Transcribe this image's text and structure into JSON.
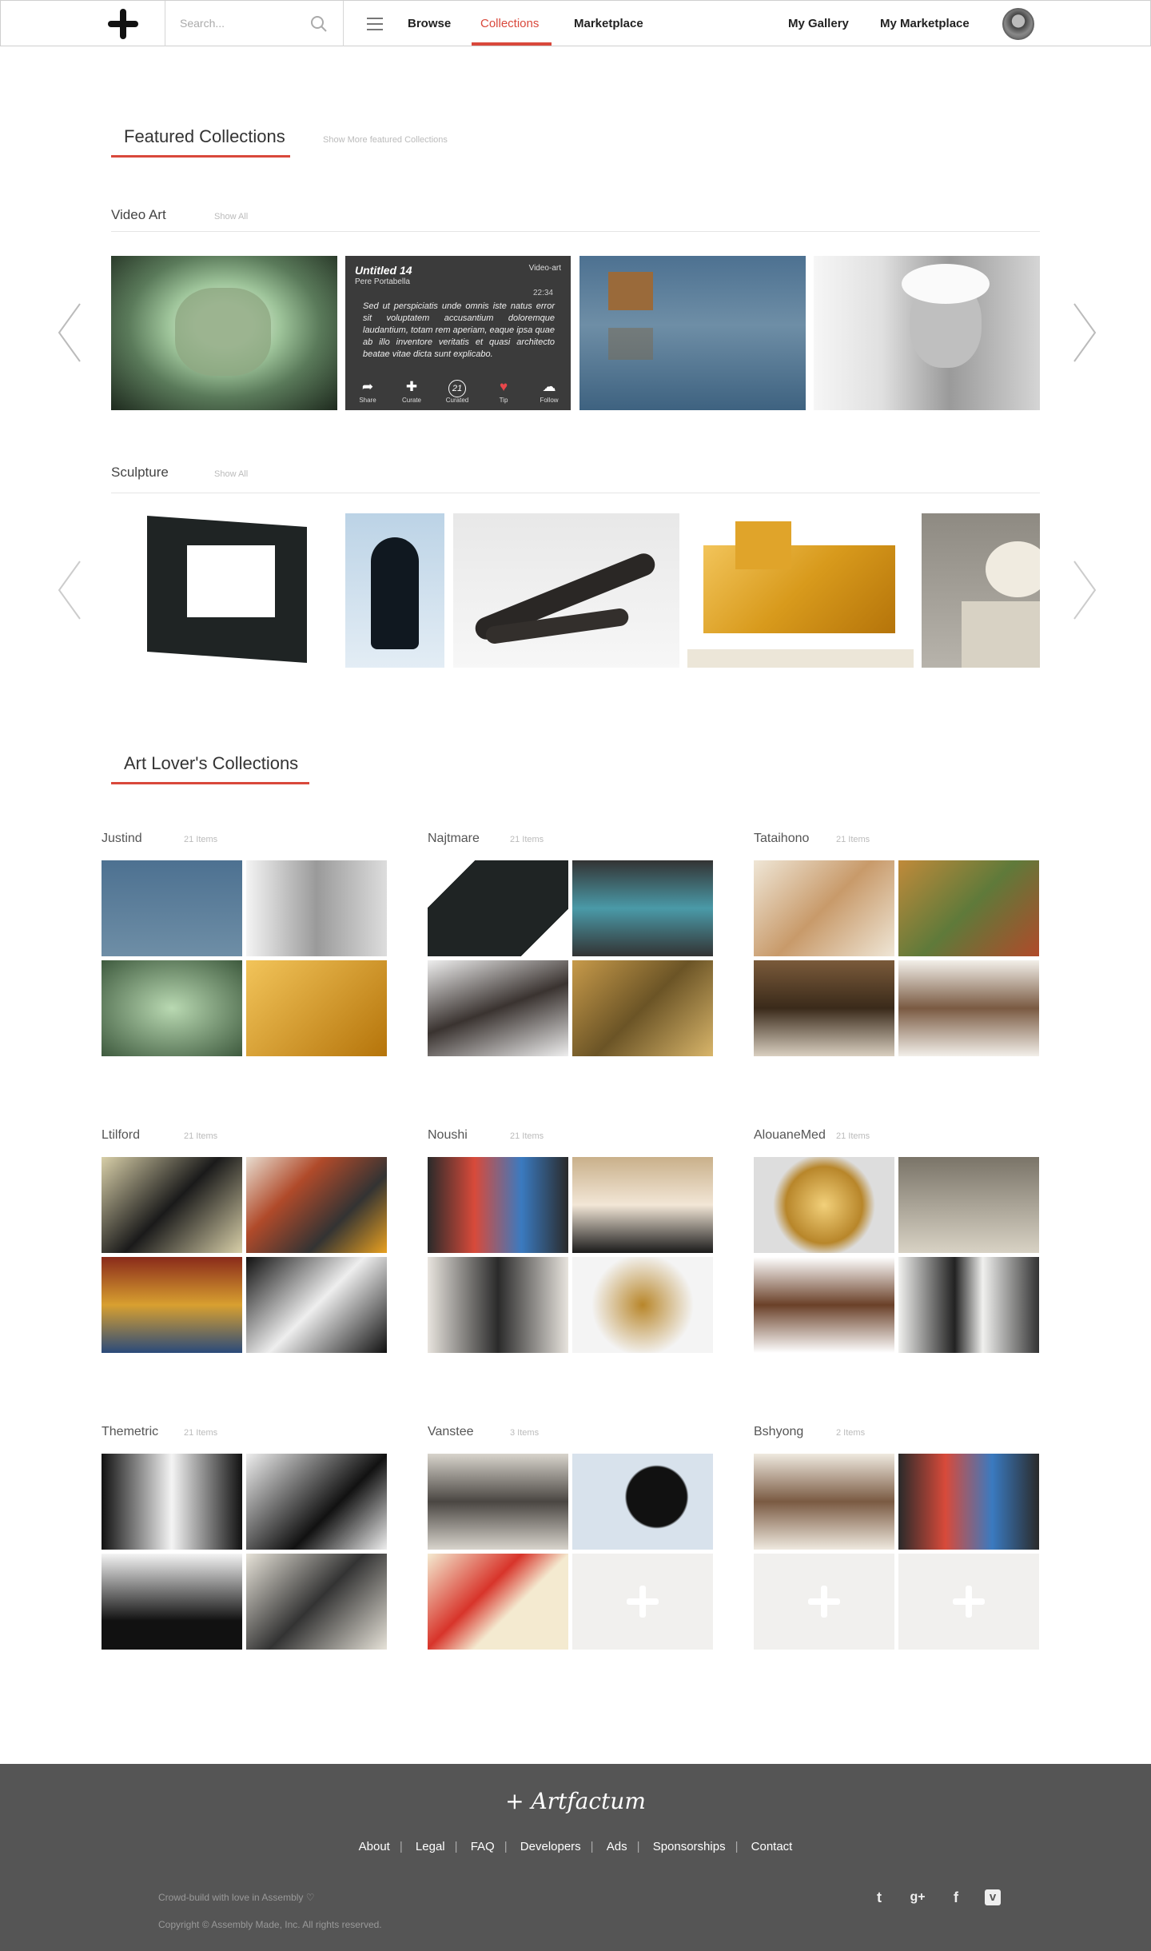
{
  "header": {
    "search_placeholder": "Search...",
    "nav": {
      "browse": "Browse",
      "collections": "Collections",
      "marketplace": "Marketplace",
      "my_gallery": "My Gallery",
      "my_marketplace": "My Marketplace"
    }
  },
  "featured": {
    "title": "Featured Collections",
    "more_link": "Show More featured Collections",
    "rows": [
      {
        "title": "Video Art",
        "show_all": "Show All"
      },
      {
        "title": "Sculpture",
        "show_all": "Show All"
      }
    ],
    "overlay": {
      "title": "Untitled 14",
      "author": "Pere Portabella",
      "tag": "Video-art",
      "duration": "22:34",
      "description": "Sed ut perspiciatis unde omnis iste natus error sit voluptatem accusantium doloremque laudantium, totam rem aperiam, eaque ipsa quae ab illo inventore veritatis et quasi architecto beatae vitae dicta sunt explicabo.",
      "actions": {
        "share": "Share",
        "curate": "Curate",
        "curated_count": "21",
        "curated": "Curated",
        "tip": "Tip",
        "follow": "Follow"
      }
    }
  },
  "art_lovers": {
    "title": "Art Lover's Collections",
    "collections": [
      {
        "name": "Justind",
        "count": "21 Items"
      },
      {
        "name": "Najtmare",
        "count": "21 Items"
      },
      {
        "name": "Tataihono",
        "count": "21 Items"
      },
      {
        "name": "Ltilford",
        "count": "21 Items"
      },
      {
        "name": "Noushi",
        "count": "21 Items"
      },
      {
        "name": "AlouaneMed",
        "count": "21 Items"
      },
      {
        "name": "Themetric",
        "count": "21 Items"
      },
      {
        "name": "Vanstee",
        "count": "3 Items"
      },
      {
        "name": "Bshyong",
        "count": "2 Items"
      }
    ]
  },
  "footer": {
    "logo": "+ Artfactum",
    "links": [
      "About",
      "Legal",
      "FAQ",
      "Developers",
      "Ads",
      "Sponsorships",
      "Contact"
    ],
    "tagline": "Crowd-build with love in Assembly ♡",
    "copyright": "Copyright © Assembly Made, Inc. All rights reserved.",
    "social": [
      "twitter-icon",
      "google-plus-icon",
      "facebook-icon",
      "vimeo-icon"
    ]
  }
}
